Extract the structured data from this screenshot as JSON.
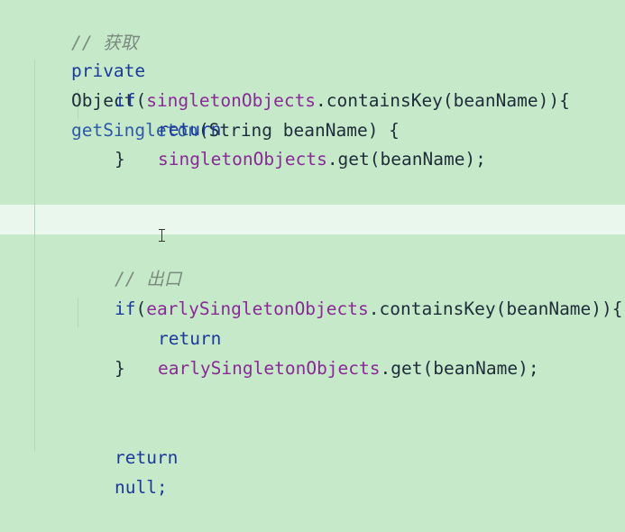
{
  "editor": {
    "lines": {
      "comment_get": "// 获取",
      "method_kw": "private",
      "method_type": "Object",
      "method_name": "getSingleton",
      "method_params": "(String beanName) {",
      "if1_kw": "if",
      "if1_open": "(",
      "if1_field": "singletonObjects",
      "if1_rest": ".containsKey(beanName)){",
      "ret1_kw": "return",
      "ret1_field": "singletonObjects",
      "ret1_rest": ".get(beanName);",
      "close1": "}",
      "comment_exit": "// 出口",
      "if2_kw": "if",
      "if2_open": "(",
      "if2_field": "earlySingletonObjects",
      "if2_rest": ".containsKey(beanName)){",
      "ret2_kw": "return",
      "ret2_field": "earlySingletonObjects",
      "ret2_rest": ".get(beanName);",
      "close2": "}",
      "ret3_kw": "return",
      "ret3_rest": "null;"
    }
  }
}
